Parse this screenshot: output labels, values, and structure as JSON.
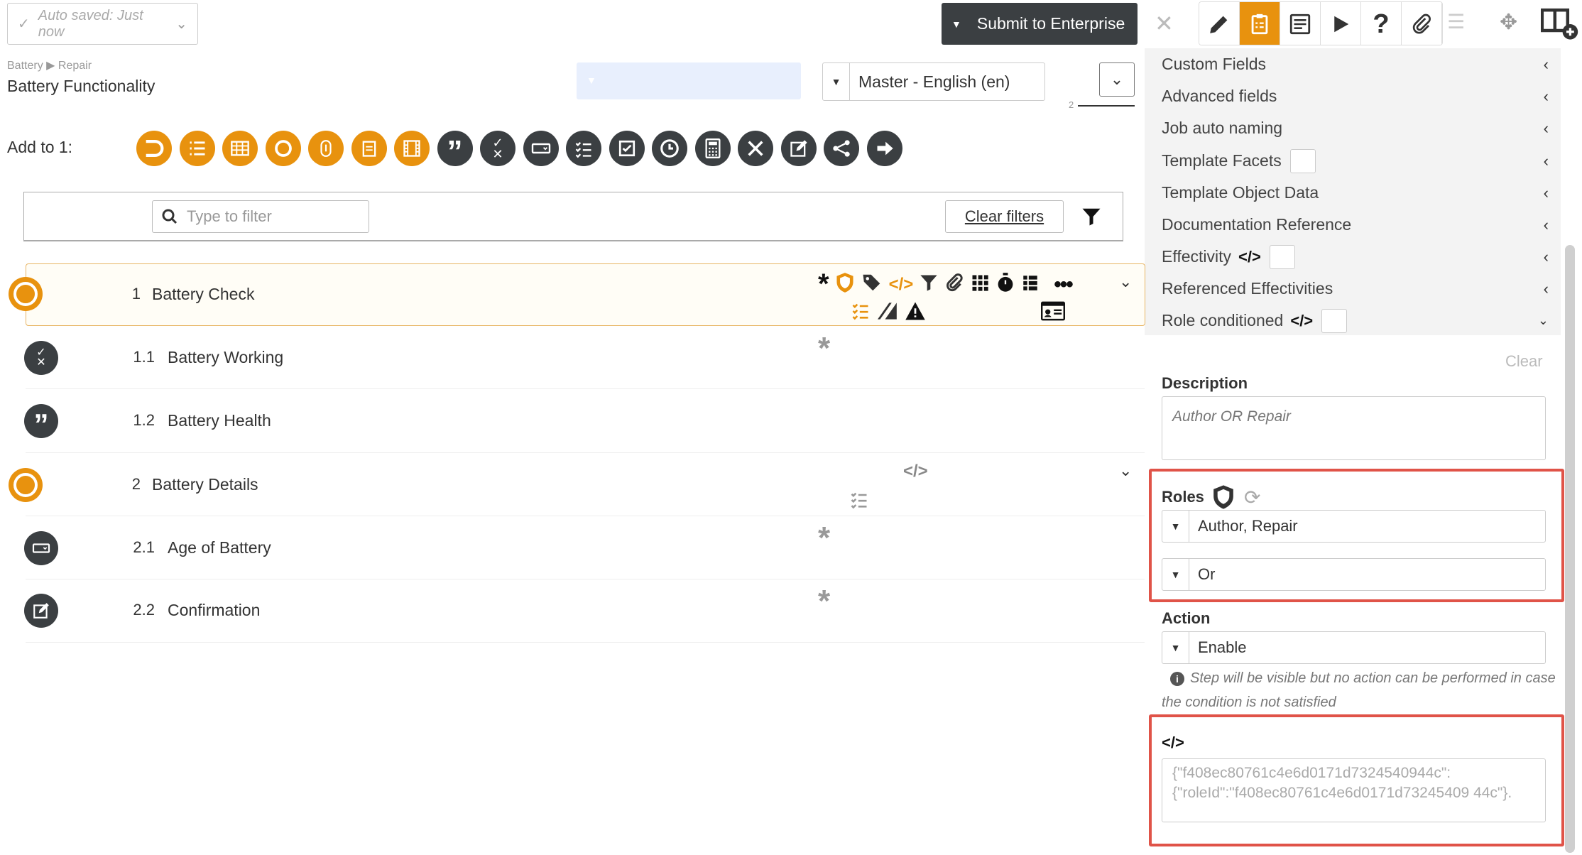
{
  "header": {
    "autosave_text": "Auto saved: Just now",
    "submit_label": "Submit to Enterprise"
  },
  "toolbar_icons": [
    "pencil-icon",
    "clipboard-icon",
    "checklist-icon",
    "play-icon",
    "help-icon",
    "paperclip-icon"
  ],
  "breadcrumb": {
    "parent": "Battery",
    "child": "Repair"
  },
  "page_title": "Battery Functionality",
  "language": "Master - English (en)",
  "revision_marker": "2",
  "add_to_label": "Add to 1:",
  "filter": {
    "placeholder": "Type to filter",
    "clear_label": "Clear filters"
  },
  "steps": [
    {
      "number": "1",
      "title": "Battery Check"
    },
    {
      "number": "1.1",
      "title": "Battery Working"
    },
    {
      "number": "1.2",
      "title": "Battery Health"
    },
    {
      "number": "2",
      "title": "Battery Details"
    },
    {
      "number": "2.1",
      "title": "Age of Battery"
    },
    {
      "number": "2.2",
      "title": "Confirmation"
    }
  ],
  "right_panel": {
    "items": [
      "Custom Fields",
      "Advanced fields",
      "Job auto naming",
      "Template Facets",
      "Template Object Data",
      "Documentation Reference",
      "Effectivity",
      "Referenced Effectivities",
      "Role conditioned"
    ],
    "clear_label": "Clear",
    "description_label": "Description",
    "description_value": "Author OR Repair",
    "roles_label": "Roles",
    "roles_value": "Author, Repair",
    "operator_value": "Or",
    "action_label": "Action",
    "action_value": "Enable",
    "help_text": "Step will be visible but no action can be performed in case the condition is not satisfied",
    "code_label": "</>",
    "code_value": "{\"f408ec80761c4e6d0171d7324540944c\": {\"roleId\":\"f408ec80761c4e6d0171d73245409 44c\"}."
  },
  "colors": {
    "accent": "#e8920e",
    "dark": "#3b3f42",
    "highlight": "#e05348"
  }
}
